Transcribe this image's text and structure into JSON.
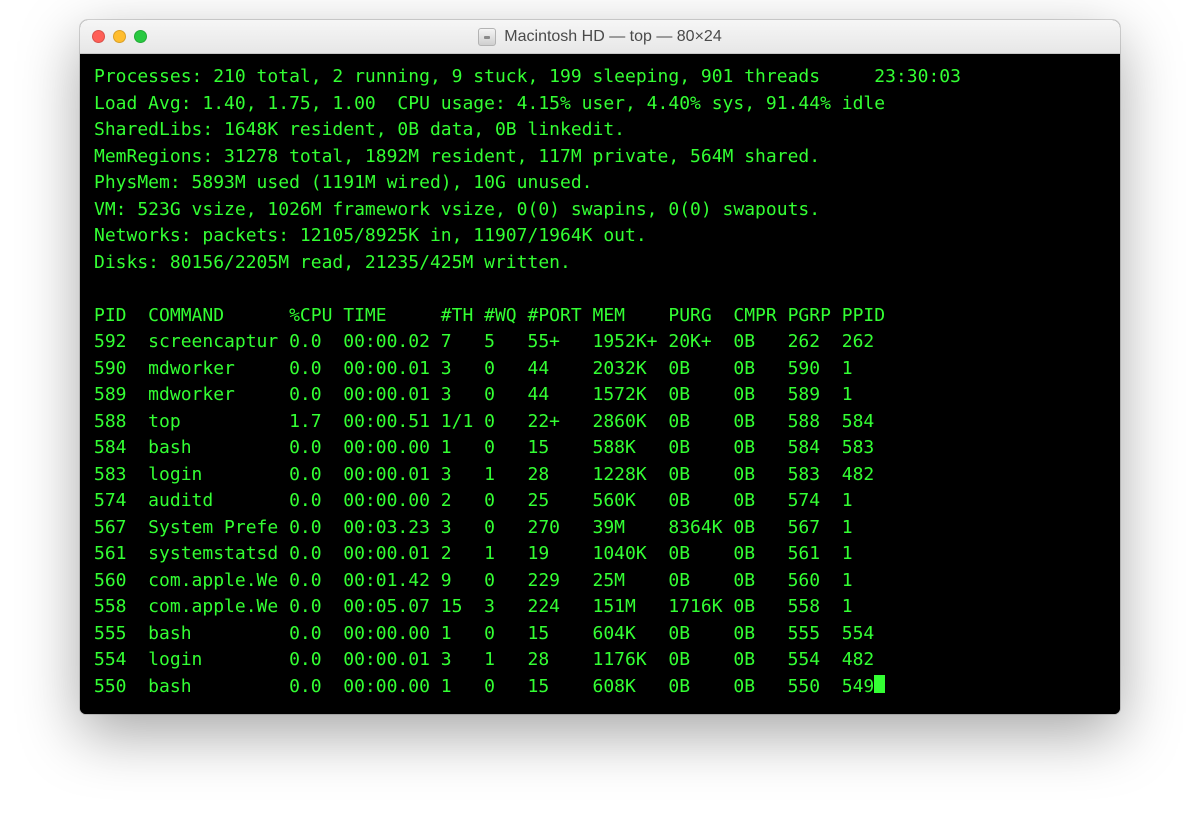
{
  "window_title": "Macintosh HD — top — 80×24",
  "traffic_colors": {
    "close": "#ff5f57",
    "min": "#ffbd2e",
    "max": "#28c940"
  },
  "header": {
    "processes": "Processes: 210 total, 2 running, 9 stuck, 199 sleeping, 901 threads",
    "time": "23:30:03",
    "loadavg": "Load Avg: 1.40, 1.75, 1.00  CPU usage: 4.15% user, 4.40% sys, 91.44% idle",
    "sharedlibs": "SharedLibs: 1648K resident, 0B data, 0B linkedit.",
    "memregions": "MemRegions: 31278 total, 1892M resident, 117M private, 564M shared.",
    "physmem": "PhysMem: 5893M used (1191M wired), 10G unused.",
    "vm": "VM: 523G vsize, 1026M framework vsize, 0(0) swapins, 0(0) swapouts.",
    "networks": "Networks: packets: 12105/8925K in, 11907/1964K out.",
    "disks": "Disks: 80156/2205M read, 21235/425M written."
  },
  "columns": [
    "PID",
    "COMMAND",
    "%CPU",
    "TIME",
    "#TH",
    "#WQ",
    "#PORT",
    "MEM",
    "PURG",
    "CMPR",
    "PGRP",
    "PPID"
  ],
  "rows": [
    {
      "PID": "592",
      "COMMAND": "screencaptur",
      "%CPU": "0.0",
      "TIME": "00:00.02",
      "#TH": "7",
      "#WQ": "5",
      "#PORT": "55+",
      "MEM": "1952K+",
      "PURG": "20K+",
      "CMPR": "0B",
      "PGRP": "262",
      "PPID": "262"
    },
    {
      "PID": "590",
      "COMMAND": "mdworker",
      "%CPU": "0.0",
      "TIME": "00:00.01",
      "#TH": "3",
      "#WQ": "0",
      "#PORT": "44",
      "MEM": "2032K",
      "PURG": "0B",
      "CMPR": "0B",
      "PGRP": "590",
      "PPID": "1"
    },
    {
      "PID": "589",
      "COMMAND": "mdworker",
      "%CPU": "0.0",
      "TIME": "00:00.01",
      "#TH": "3",
      "#WQ": "0",
      "#PORT": "44",
      "MEM": "1572K",
      "PURG": "0B",
      "CMPR": "0B",
      "PGRP": "589",
      "PPID": "1"
    },
    {
      "PID": "588",
      "COMMAND": "top",
      "%CPU": "1.7",
      "TIME": "00:00.51",
      "#TH": "1/1",
      "#WQ": "0",
      "#PORT": "22+",
      "MEM": "2860K",
      "PURG": "0B",
      "CMPR": "0B",
      "PGRP": "588",
      "PPID": "584"
    },
    {
      "PID": "584",
      "COMMAND": "bash",
      "%CPU": "0.0",
      "TIME": "00:00.00",
      "#TH": "1",
      "#WQ": "0",
      "#PORT": "15",
      "MEM": "588K",
      "PURG": "0B",
      "CMPR": "0B",
      "PGRP": "584",
      "PPID": "583"
    },
    {
      "PID": "583",
      "COMMAND": "login",
      "%CPU": "0.0",
      "TIME": "00:00.01",
      "#TH": "3",
      "#WQ": "1",
      "#PORT": "28",
      "MEM": "1228K",
      "PURG": "0B",
      "CMPR": "0B",
      "PGRP": "583",
      "PPID": "482"
    },
    {
      "PID": "574",
      "COMMAND": "auditd",
      "%CPU": "0.0",
      "TIME": "00:00.00",
      "#TH": "2",
      "#WQ": "0",
      "#PORT": "25",
      "MEM": "560K",
      "PURG": "0B",
      "CMPR": "0B",
      "PGRP": "574",
      "PPID": "1"
    },
    {
      "PID": "567",
      "COMMAND": "System Prefe",
      "%CPU": "0.0",
      "TIME": "00:03.23",
      "#TH": "3",
      "#WQ": "0",
      "#PORT": "270",
      "MEM": "39M",
      "PURG": "8364K",
      "CMPR": "0B",
      "PGRP": "567",
      "PPID": "1"
    },
    {
      "PID": "561",
      "COMMAND": "systemstatsd",
      "%CPU": "0.0",
      "TIME": "00:00.01",
      "#TH": "2",
      "#WQ": "1",
      "#PORT": "19",
      "MEM": "1040K",
      "PURG": "0B",
      "CMPR": "0B",
      "PGRP": "561",
      "PPID": "1"
    },
    {
      "PID": "560",
      "COMMAND": "com.apple.We",
      "%CPU": "0.0",
      "TIME": "00:01.42",
      "#TH": "9",
      "#WQ": "0",
      "#PORT": "229",
      "MEM": "25M",
      "PURG": "0B",
      "CMPR": "0B",
      "PGRP": "560",
      "PPID": "1"
    },
    {
      "PID": "558",
      "COMMAND": "com.apple.We",
      "%CPU": "0.0",
      "TIME": "00:05.07",
      "#TH": "15",
      "#WQ": "3",
      "#PORT": "224",
      "MEM": "151M",
      "PURG": "1716K",
      "CMPR": "0B",
      "PGRP": "558",
      "PPID": "1"
    },
    {
      "PID": "555",
      "COMMAND": "bash",
      "%CPU": "0.0",
      "TIME": "00:00.00",
      "#TH": "1",
      "#WQ": "0",
      "#PORT": "15",
      "MEM": "604K",
      "PURG": "0B",
      "CMPR": "0B",
      "PGRP": "555",
      "PPID": "554"
    },
    {
      "PID": "554",
      "COMMAND": "login",
      "%CPU": "0.0",
      "TIME": "00:00.01",
      "#TH": "3",
      "#WQ": "1",
      "#PORT": "28",
      "MEM": "1176K",
      "PURG": "0B",
      "CMPR": "0B",
      "PGRP": "554",
      "PPID": "482"
    },
    {
      "PID": "550",
      "COMMAND": "bash",
      "%CPU": "0.0",
      "TIME": "00:00.00",
      "#TH": "1",
      "#WQ": "0",
      "#PORT": "15",
      "MEM": "608K",
      "PURG": "0B",
      "CMPR": "0B",
      "PGRP": "550",
      "PPID": "549"
    }
  ],
  "col_widths": {
    "PID": 5,
    "COMMAND": 13,
    "%CPU": 5,
    "TIME": 9,
    "#TH": 4,
    "#WQ": 4,
    "#PORT": 6,
    "MEM": 7,
    "PURG": 6,
    "CMPR": 5,
    "PGRP": 5,
    "PPID": 4
  }
}
